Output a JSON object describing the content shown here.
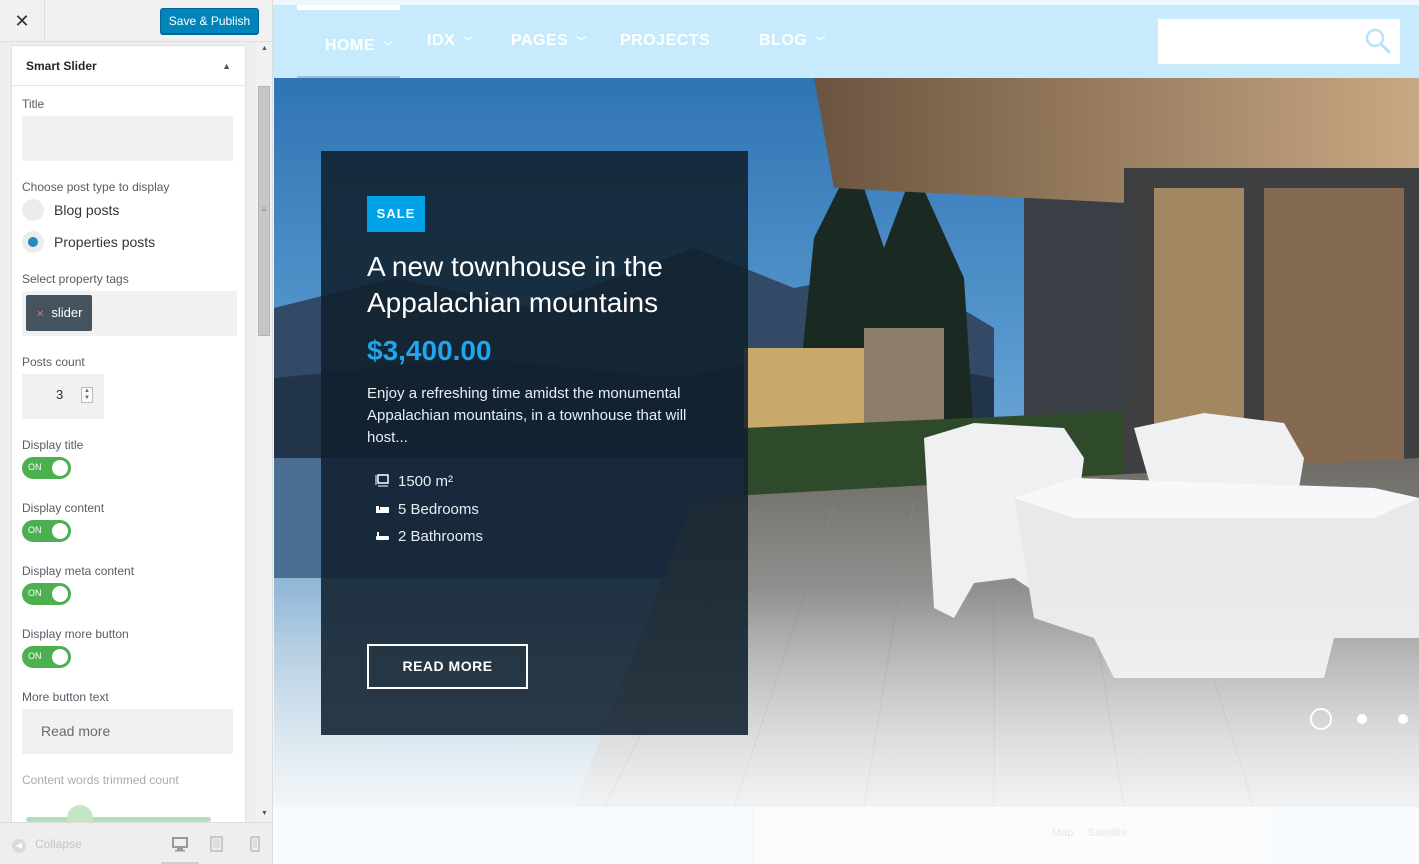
{
  "customizer": {
    "close_icon": "close-icon",
    "publish_label": "Save & Publish",
    "section_title": "Smart Slider",
    "fields": {
      "title_label": "Title",
      "title_value": "",
      "post_type_label": "Choose post type to display",
      "post_type_options": [
        "Blog posts",
        "Properties posts"
      ],
      "post_type_selected": "Properties posts",
      "tags_label": "Select property tags",
      "tags": [
        "slider"
      ],
      "posts_count_label": "Posts count",
      "posts_count": "3",
      "toggles": [
        {
          "label": "Display title",
          "state": "ON"
        },
        {
          "label": "Display content",
          "state": "ON"
        },
        {
          "label": "Display meta content",
          "state": "ON"
        },
        {
          "label": "Display more button",
          "state": "ON"
        }
      ],
      "more_button_label": "More button text",
      "more_button_value": "Read more",
      "trim_label": "Content words trimmed count"
    },
    "footer": {
      "collapse_label": "Collapse",
      "devices": [
        "desktop-icon",
        "tablet-icon",
        "mobile-icon"
      ],
      "active_device": "desktop"
    }
  },
  "site": {
    "nav": [
      {
        "label": "HOME",
        "dropdown": true,
        "active": true
      },
      {
        "label": "IDX",
        "dropdown": true
      },
      {
        "label": "PAGES",
        "dropdown": true
      },
      {
        "label": "PROJECTS",
        "dropdown": false
      },
      {
        "label": "BLOG",
        "dropdown": true
      }
    ],
    "search_placeholder": "",
    "slide": {
      "badge": "SALE",
      "title": "A new townhouse in the Appalachian mountains",
      "price": "$3,400.00",
      "description": "Enjoy a refreshing time amidst the monumental Appalachian mountains, in a townhouse that will host...",
      "meta": [
        {
          "icon": "area-icon",
          "text": "1500 m²"
        },
        {
          "icon": "bed-icon",
          "text": "5 Bedrooms"
        },
        {
          "icon": "bath-icon",
          "text": "2 Bathrooms"
        }
      ],
      "cta": "READ MORE"
    },
    "slider_dots": 3,
    "active_dot": 1,
    "map_tabs": [
      "Map",
      "Satellite"
    ]
  }
}
